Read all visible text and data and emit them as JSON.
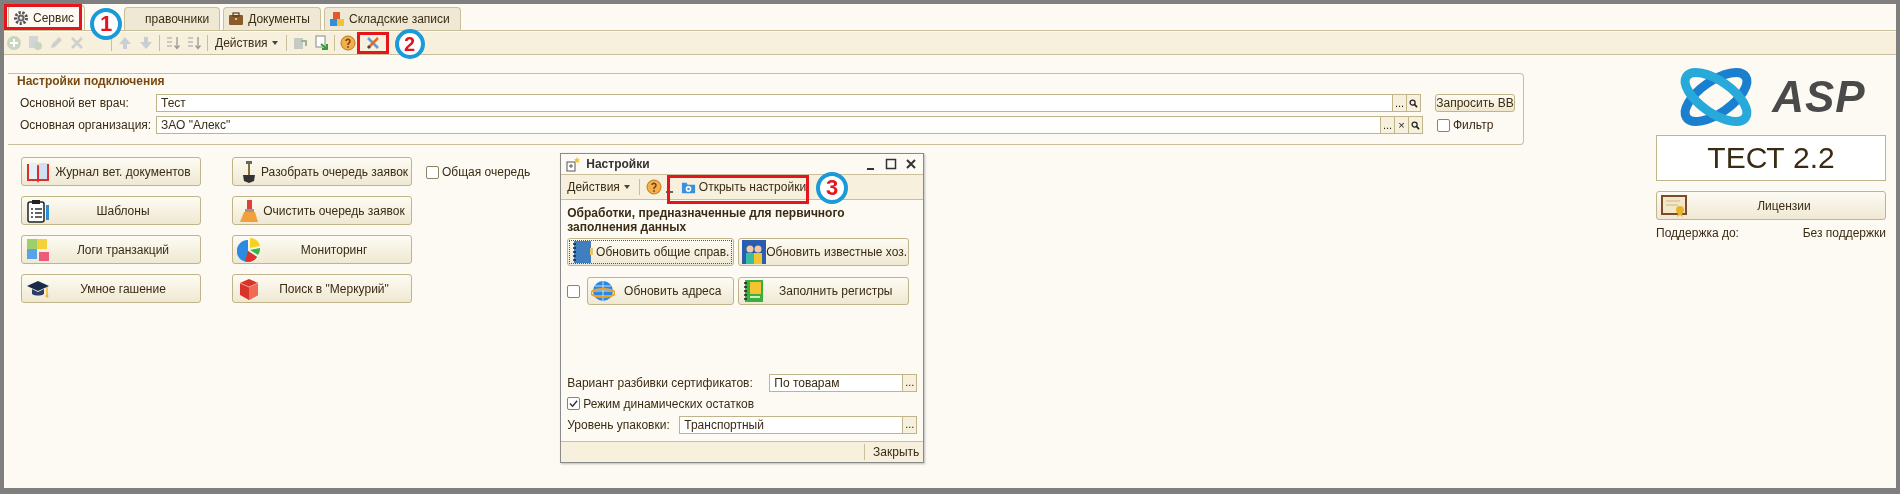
{
  "tabs": [
    {
      "label": "Сервис",
      "selected": true
    },
    {
      "label": "правочники",
      "selected": false
    },
    {
      "label": "Документы",
      "selected": false
    },
    {
      "label": "Складские записи",
      "selected": false
    }
  ],
  "toolbar": {
    "actions_label": "Действия"
  },
  "connection": {
    "title": "Настройки подключения",
    "fields": [
      {
        "label": "Основной вет врач:",
        "value": "Тест",
        "buttons": [
          {
            "kind": "choose",
            "text": "..."
          },
          {
            "kind": "search"
          }
        ]
      },
      {
        "label": "Основная организация:",
        "value": "ЗАО \"Алекс\"",
        "buttons": [
          {
            "kind": "choose",
            "text": "..."
          },
          {
            "kind": "clear",
            "text": "×"
          },
          {
            "kind": "search"
          }
        ]
      }
    ],
    "request_button": "Запросить ВВ",
    "filter": {
      "label": "Фильтр",
      "checked": false
    }
  },
  "buttons": [
    "Журнал вет. документов",
    "Шаблоны",
    "Логи транзакций",
    "Умное гашение",
    "Разобрать очередь заявок",
    "Очистить очередь заявок",
    "Мониторинг",
    "Поиск в \"Меркурий\""
  ],
  "queue_checkbox": {
    "label": "Общая очередь",
    "checked": false
  },
  "dialog": {
    "title": "Настройки",
    "actions_label": "Действия",
    "open_settings": "Открыть настройки",
    "heading": "Обработки, предназначенные для первичного заполнения данных",
    "buttons": [
      {
        "label": "Обновить общие справ.",
        "focused": true
      },
      {
        "label": "Обновить известные хоз.",
        "focused": false
      },
      {
        "label": "Обновить адреса",
        "focused": false
      },
      {
        "label": "Заполнить регистры",
        "focused": false
      }
    ],
    "address_checkbox": {
      "checked": false
    },
    "split_field": {
      "label": "Вариант разбивки сертификатов:",
      "value": "По товарам",
      "button": "..."
    },
    "dynamic_checkbox": {
      "label": "Режим динамических остатков",
      "checked": true
    },
    "pack_field": {
      "label": "Уровень упаковки:",
      "value": "Транспортный",
      "button": "..."
    },
    "close": "Закрыть"
  },
  "brand": {
    "logo": "ASP",
    "version": "ТЕСТ 2.2",
    "license_button": "Лицензии",
    "support_label": "Поддержка до:",
    "support_value": "Без поддержки"
  },
  "callouts": [
    "1",
    "2",
    "3"
  ]
}
